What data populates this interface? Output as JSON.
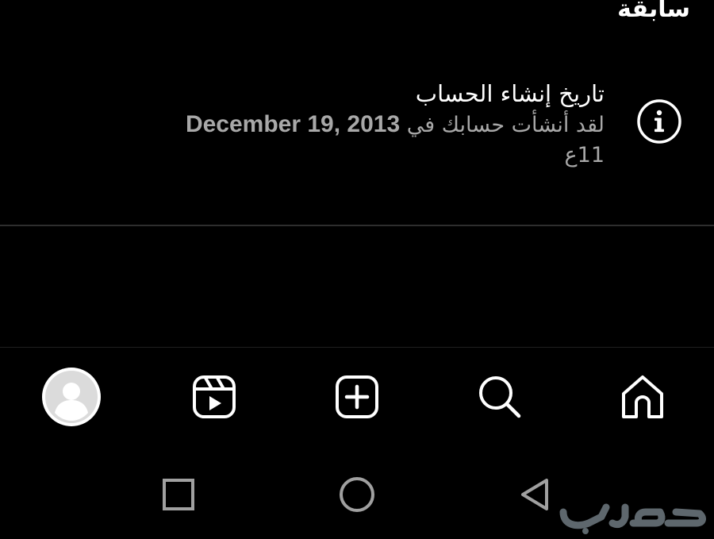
{
  "header": {
    "partial_label": "سابقة"
  },
  "account_info": {
    "icon": "info-icon",
    "title": "تاريخ إنشاء الحساب",
    "description_prefix": "لقد أنشأت حسابك في",
    "date": "December 19, 2013",
    "time_ago": "11ع"
  },
  "bottom_nav": {
    "items": [
      {
        "icon": "home-icon"
      },
      {
        "icon": "search-icon"
      },
      {
        "icon": "create-post-icon"
      },
      {
        "icon": "reels-icon"
      },
      {
        "icon": "profile-avatar"
      }
    ]
  },
  "system_nav": {
    "items": [
      {
        "icon": "back-triangle-icon"
      },
      {
        "icon": "home-circle-icon"
      },
      {
        "icon": "recent-apps-square-icon"
      }
    ]
  },
  "watermark": {
    "text": "حراج"
  }
}
